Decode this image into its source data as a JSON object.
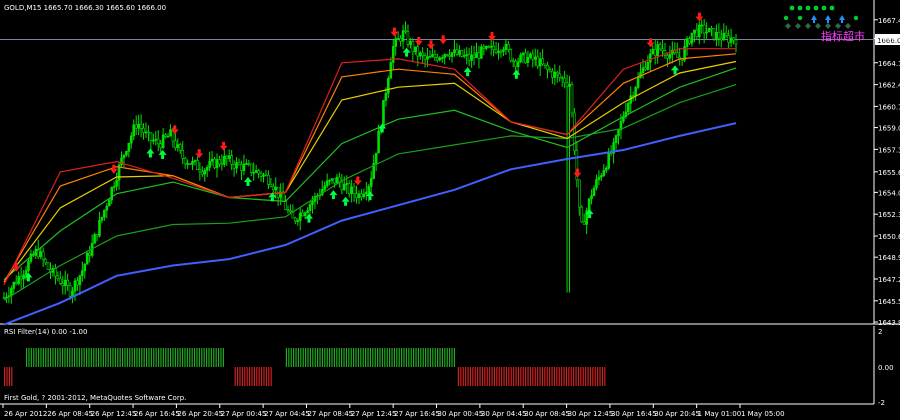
{
  "symbol_header": "GOLD,M15  1665.70 1666.30 1665.60 1666.00",
  "chinese_label": "指标超市",
  "current_price_label": "1666.00",
  "sub_panel_label": "RSI Filter(14) 0.00 -1.00",
  "footer_text": "First Gold, ? 2001-2012, MetaQuotes Software Corp.",
  "colors": {
    "background": "#000000",
    "grid": "#ffffff",
    "candles": "#00e000",
    "up_arrow": "#00ff44",
    "down_arrow": "#ff1a1a",
    "rsi_up": "#22aa22",
    "rsi_down": "#cc2222",
    "ma_slowest": "#4060ff",
    "ma_slow": "#18a018",
    "ma_green2": "#20c020",
    "ma_yellow": "#e8d000",
    "ma_orange": "#ff8000",
    "ma_red": "#e02020",
    "ma_purple": "#c040ff",
    "chinese_label": "#ff40ff"
  },
  "chart_data": {
    "type": "candlestick",
    "title": "GOLD,M15",
    "ohlc_header": {
      "open": 1665.7,
      "high": 1666.3,
      "low": 1665.6,
      "close": 1666.0
    },
    "y_ticks": [
      "1667.45",
      "1666.00",
      "1664.10",
      "1662.40",
      "1660.70",
      "1659.05",
      "1657.35",
      "1655.60",
      "1654.00",
      "1652.30",
      "1650.60",
      "1648.95",
      "1647.25",
      "1645.55",
      "1643.90"
    ],
    "x_ticks": [
      "26 Apr 2012",
      "26 Apr 08:45",
      "26 Apr 12:45",
      "26 Apr 16:45",
      "26 Apr 20:45",
      "27 Apr 00:45",
      "27 Apr 04:45",
      "27 Apr 08:45",
      "27 Apr 12:45",
      "27 Apr 16:45",
      "30 Apr 00:45",
      "30 Apr 04:45",
      "30 Apr 08:45",
      "30 Apr 12:45",
      "30 Apr 16:45",
      "30 Apr 20:45",
      "1 May 01:00",
      "1 May 05:00"
    ],
    "ylim": [
      1643.9,
      1667.9
    ],
    "price_path": [
      1645.8,
      1647.0,
      1648.2,
      1649.5,
      1648.0,
      1647.2,
      1646.3,
      1647.8,
      1650.0,
      1652.5,
      1655.0,
      1657.5,
      1659.5,
      1658.2,
      1657.8,
      1658.5,
      1656.8,
      1656.2,
      1655.8,
      1656.3,
      1656.6,
      1656.1,
      1655.9,
      1655.5,
      1655.0,
      1653.5,
      1651.8,
      1652.6,
      1653.5,
      1654.6,
      1655.0,
      1654.2,
      1653.8,
      1654.8,
      1659.5,
      1665.2,
      1666.4,
      1665.0,
      1664.3,
      1664.6,
      1665.0,
      1664.7,
      1664.4,
      1664.9,
      1665.1,
      1665.5,
      1664.2,
      1664.5,
      1664.3,
      1663.5,
      1663.0,
      1662.5,
      1651.0,
      1654.0,
      1655.8,
      1657.5,
      1660.5,
      1662.5,
      1664.3,
      1665.3,
      1664.8,
      1664.4,
      1666.4,
      1666.7,
      1666.3,
      1666.0,
      1666.0
    ],
    "ma_series": [
      {
        "name": "",
        "color": "#4060ff",
        "values": [
          1643.7,
          1645.4,
          1647.5,
          1648.3,
          1648.8,
          1649.9,
          1651.8,
          1653.0,
          1654.2,
          1655.8,
          1656.6,
          1657.3,
          1658.4,
          1659.4
        ]
      },
      {
        "name": "",
        "color": "#18a018",
        "values": [
          1645.6,
          1648.3,
          1650.6,
          1651.5,
          1651.6,
          1652.1,
          1654.9,
          1657.0,
          1657.7,
          1658.4,
          1658.2,
          1659.0,
          1661.0,
          1662.4
        ]
      },
      {
        "name": "",
        "color": "#20c020",
        "values": [
          1647.2,
          1651.0,
          1653.9,
          1654.8,
          1653.6,
          1653.3,
          1657.8,
          1659.7,
          1660.4,
          1658.8,
          1657.5,
          1659.9,
          1662.2,
          1663.7
        ]
      },
      {
        "name": "",
        "color": "#e8d000",
        "values": [
          1647.0,
          1652.8,
          1655.2,
          1655.3,
          1653.6,
          1654.0,
          1661.2,
          1662.2,
          1662.5,
          1659.5,
          1658.2,
          1661.0,
          1663.3,
          1664.2
        ]
      },
      {
        "name": "",
        "color": "#ff8000",
        "values": [
          1647.0,
          1654.5,
          1656.0,
          1655.3,
          1653.6,
          1654.0,
          1663.0,
          1663.6,
          1663.2,
          1659.5,
          1658.5,
          1662.5,
          1664.4,
          1664.8
        ]
      },
      {
        "name": "",
        "color": "#e02020",
        "values": [
          1646.8,
          1655.6,
          1656.4,
          1655.1,
          1653.6,
          1654.0,
          1664.1,
          1664.4,
          1663.6,
          1659.5,
          1658.5,
          1663.6,
          1665.2,
          1665.2
        ]
      }
    ],
    "sell_signals": [
      1,
      9,
      14,
      16,
      18,
      29,
      32,
      34,
      35,
      36,
      40,
      47,
      53,
      57
    ],
    "buy_signals": [
      2,
      12,
      13,
      20,
      22,
      25,
      27,
      28,
      30,
      31,
      33,
      38,
      42,
      48,
      55
    ],
    "rsi_panel": {
      "y_ticks": [
        "2",
        "0.00",
        "-2"
      ],
      "green_segments": [
        [
          0.03,
          0.3
        ],
        [
          0.385,
          0.615
        ]
      ],
      "red_segments": [
        [
          0.0,
          0.011
        ],
        [
          0.315,
          0.365
        ],
        [
          0.62,
          0.82
        ]
      ]
    }
  }
}
